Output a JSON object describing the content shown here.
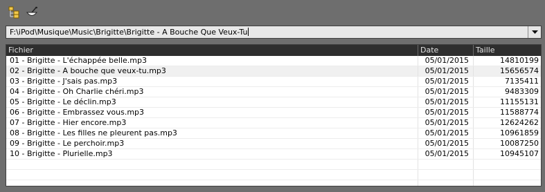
{
  "toolbar": {
    "icons": [
      "folder-tree-icon",
      "bowl-spoon-icon"
    ]
  },
  "pathbar": {
    "value": "F:\\iPod\\Musique\\Music\\Brigitte\\Brigitte - A Bouche Que Veux-Tu"
  },
  "columns": {
    "name": "Fichier",
    "date": "Date",
    "size": "Taille"
  },
  "files": [
    {
      "name": "01 - Brigitte - L'échappée belle.mp3",
      "date": "05/01/2015",
      "size": "14810199"
    },
    {
      "name": "02 - Brigitte - A bouche que veux-tu.mp3",
      "date": "05/01/2015",
      "size": "15656574"
    },
    {
      "name": "03 - Brigitte - J'sais pas.mp3",
      "date": "05/01/2015",
      "size": "7135411"
    },
    {
      "name": "04 - Brigitte - Oh Charlie chéri.mp3",
      "date": "05/01/2015",
      "size": "9483309"
    },
    {
      "name": "05 - Brigitte - Le déclin.mp3",
      "date": "05/01/2015",
      "size": "11155131"
    },
    {
      "name": "06 - Brigitte - Embrassez vous.mp3",
      "date": "05/01/2015",
      "size": "11588774"
    },
    {
      "name": "07 - Brigitte - Hier encore.mp3",
      "date": "05/01/2015",
      "size": "12624262"
    },
    {
      "name": "08 - Brigitte - Les filles ne pleurent pas.mp3",
      "date": "05/01/2015",
      "size": "10961859"
    },
    {
      "name": "09 - Brigitte - Le perchoir.mp3",
      "date": "05/01/2015",
      "size": "10087250"
    },
    {
      "name": "10 - Brigitte - Plurielle.mp3",
      "date": "05/01/2015",
      "size": "10945107"
    }
  ]
}
